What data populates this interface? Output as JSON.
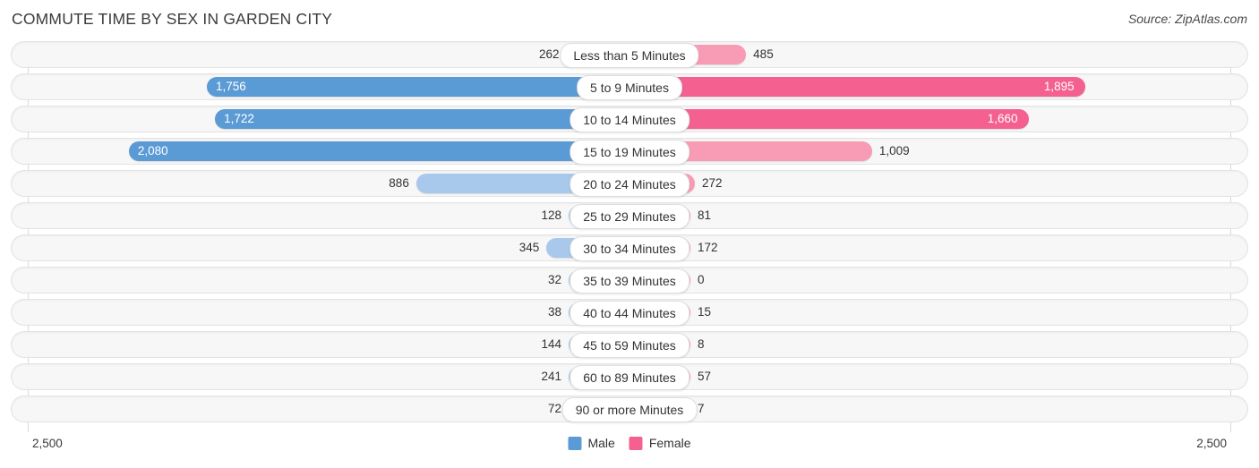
{
  "header": {
    "title": "COMMUTE TIME BY SEX IN GARDEN CITY",
    "source": "Source: ZipAtlas.com"
  },
  "axis": {
    "left_label": "2,500",
    "right_label": "2,500"
  },
  "legend": {
    "items": [
      {
        "label": "Male",
        "color": "#5B9BD5"
      },
      {
        "label": "Female",
        "color": "#F4608F"
      }
    ]
  },
  "colors": {
    "male_strong": "#5B9BD5",
    "male_light": "#A8C8EC",
    "female_strong": "#F4608F",
    "female_light": "#F89BB5",
    "track_fill": "#f7f7f7",
    "track_border": "#e3e3e3",
    "gridline": "#d9d9d9"
  },
  "chart_data": {
    "type": "bar",
    "orientation": "horizontal-diverging",
    "title": "COMMUTE TIME BY SEX IN GARDEN CITY",
    "xlabel": "",
    "ylabel": "",
    "xlim": [
      -2500,
      2500
    ],
    "axis_max": 2500,
    "grid": true,
    "legend_position": "bottom-center",
    "categories": [
      "Less than 5 Minutes",
      "5 to 9 Minutes",
      "10 to 14 Minutes",
      "15 to 19 Minutes",
      "20 to 24 Minutes",
      "25 to 29 Minutes",
      "30 to 34 Minutes",
      "35 to 39 Minutes",
      "40 to 44 Minutes",
      "45 to 59 Minutes",
      "60 to 89 Minutes",
      "90 or more Minutes"
    ],
    "series": [
      {
        "name": "Male",
        "color": "#5B9BD5",
        "side": "left",
        "values": [
          262,
          1756,
          1722,
          2080,
          886,
          128,
          345,
          32,
          38,
          144,
          241,
          72
        ],
        "labels": [
          "262",
          "1,756",
          "1,722",
          "2,080",
          "886",
          "128",
          "345",
          "32",
          "38",
          "144",
          "241",
          "72"
        ]
      },
      {
        "name": "Female",
        "color": "#F4608F",
        "side": "right",
        "values": [
          485,
          1895,
          1660,
          1009,
          272,
          81,
          172,
          0,
          15,
          8,
          57,
          7
        ],
        "labels": [
          "485",
          "1,895",
          "1,660",
          "1,009",
          "272",
          "81",
          "172",
          "0",
          "15",
          "8",
          "57",
          "7"
        ]
      }
    ],
    "rows": [
      {
        "category": "Less than 5 Minutes",
        "male": 262,
        "male_label": "262",
        "male_inside": false,
        "female": 485,
        "female_label": "485",
        "female_inside": false
      },
      {
        "category": "5 to 9 Minutes",
        "male": 1756,
        "male_label": "1,756",
        "male_inside": true,
        "female": 1895,
        "female_label": "1,895",
        "female_inside": true
      },
      {
        "category": "10 to 14 Minutes",
        "male": 1722,
        "male_label": "1,722",
        "male_inside": true,
        "female": 1660,
        "female_label": "1,660",
        "female_inside": true
      },
      {
        "category": "15 to 19 Minutes",
        "male": 2080,
        "male_label": "2,080",
        "male_inside": true,
        "female": 1009,
        "female_label": "1,009",
        "female_inside": false
      },
      {
        "category": "20 to 24 Minutes",
        "male": 886,
        "male_label": "886",
        "male_inside": false,
        "female": 272,
        "female_label": "272",
        "female_inside": false
      },
      {
        "category": "25 to 29 Minutes",
        "male": 128,
        "male_label": "128",
        "male_inside": false,
        "female": 81,
        "female_label": "81",
        "female_inside": false
      },
      {
        "category": "30 to 34 Minutes",
        "male": 345,
        "male_label": "345",
        "male_inside": false,
        "female": 172,
        "female_label": "172",
        "female_inside": false
      },
      {
        "category": "35 to 39 Minutes",
        "male": 32,
        "male_label": "32",
        "male_inside": false,
        "female": 0,
        "female_label": "0",
        "female_inside": false
      },
      {
        "category": "40 to 44 Minutes",
        "male": 38,
        "male_label": "38",
        "male_inside": false,
        "female": 15,
        "female_label": "15",
        "female_inside": false
      },
      {
        "category": "45 to 59 Minutes",
        "male": 144,
        "male_label": "144",
        "male_inside": false,
        "female": 8,
        "female_label": "8",
        "female_inside": false
      },
      {
        "category": "60 to 89 Minutes",
        "male": 241,
        "male_label": "241",
        "male_inside": false,
        "female": 57,
        "female_label": "57",
        "female_inside": false
      },
      {
        "category": "90 or more Minutes",
        "male": 72,
        "male_label": "72",
        "male_inside": false,
        "female": 7,
        "female_label": "7",
        "female_inside": false
      }
    ]
  }
}
